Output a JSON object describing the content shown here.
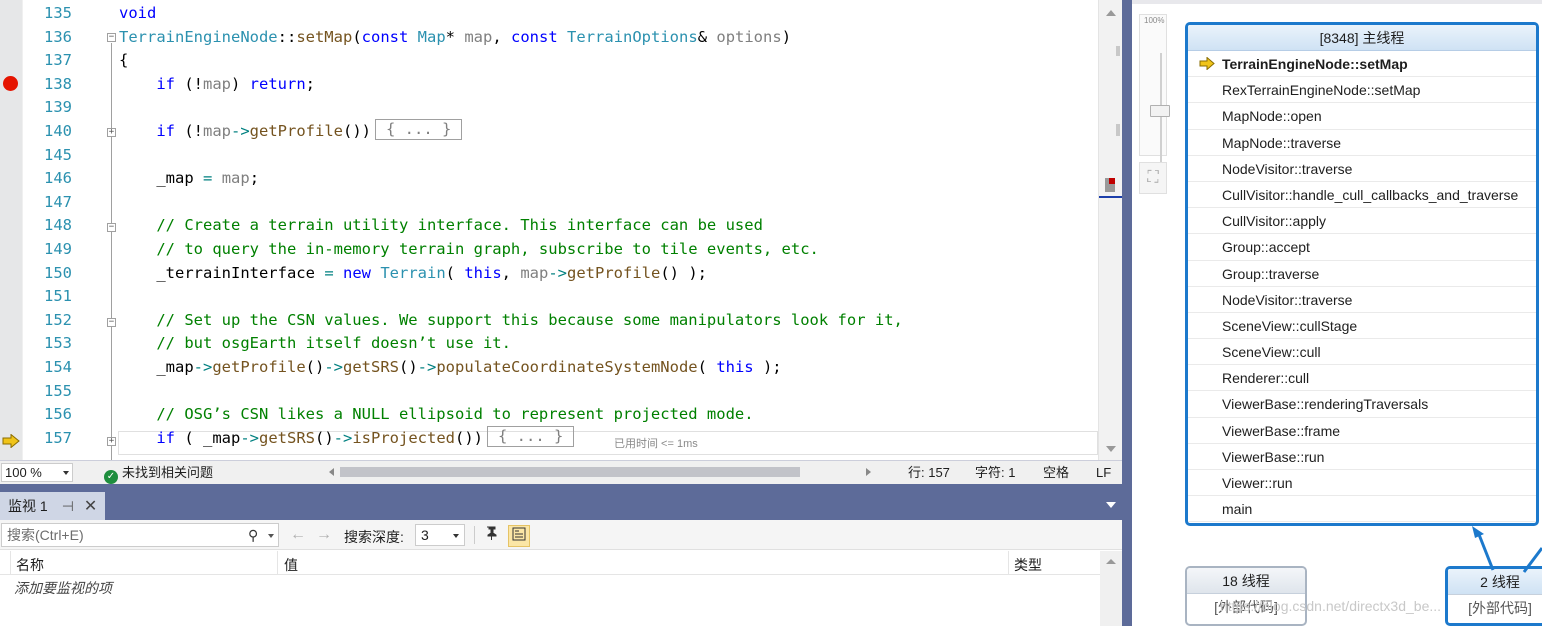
{
  "editor": {
    "lines": [
      {
        "n": "135",
        "html": "<span class=\"kw\">void</span>"
      },
      {
        "n": "136",
        "html": "<span class=\"ty\">TerrainEngineNode</span>::<span class=\"fn\">setMap</span>(<span class=\"kw\">const</span> <span class=\"ty\">Map</span>* <span class=\"mv\">map</span>, <span class=\"kw\">const</span> <span class=\"ty\">TerrainOptions</span>&amp; <span class=\"mv\">options</span>)"
      },
      {
        "n": "137",
        "html": "{"
      },
      {
        "n": "138",
        "html": "    <span class=\"kw\">if</span> (!<span class=\"mv\">map</span>) <span class=\"kw\">return</span>;"
      },
      {
        "n": "139",
        "html": ""
      },
      {
        "n": "140",
        "html": "    <span class=\"kw\">if</span> (!<span class=\"mv\">map</span><span class=\"op\">-&gt;</span><span class=\"fn\">getProfile</span>())<span class=\"collapsed\">{ ... }</span>"
      },
      {
        "n": "145",
        "html": ""
      },
      {
        "n": "146",
        "html": "    _map <span class=\"op\">=</span> <span class=\"mv\">map</span>;"
      },
      {
        "n": "147",
        "html": ""
      },
      {
        "n": "148",
        "html": "    <span class=\"cm\">// Create a terrain utility interface. This interface can be used</span>"
      },
      {
        "n": "149",
        "html": "    <span class=\"cm\">// to query the in-memory terrain graph, subscribe to tile events, etc.</span>"
      },
      {
        "n": "150",
        "html": "    _terrainInterface <span class=\"op\">=</span> <span class=\"kw\">new</span> <span class=\"ty\">Terrain</span>( <span class=\"kw\">this</span>, <span class=\"mv\">map</span><span class=\"op\">-&gt;</span><span class=\"fn\">getProfile</span>() );"
      },
      {
        "n": "151",
        "html": ""
      },
      {
        "n": "152",
        "html": "    <span class=\"cm\">// Set up the CSN values. We support this because some manipulators look for it,</span>"
      },
      {
        "n": "153",
        "html": "    <span class=\"cm\">// but osgEarth itself doesn’t use it.</span>"
      },
      {
        "n": "154",
        "html": "    _map<span class=\"op\">-&gt;</span><span class=\"fn\">getProfile</span>()<span class=\"op\">-&gt;</span><span class=\"fn\">getSRS</span>()<span class=\"op\">-&gt;</span><span class=\"fn\">populateCoordinateSystemNode</span>( <span class=\"kw\">this</span> );"
      },
      {
        "n": "155",
        "html": ""
      },
      {
        "n": "156",
        "html": "    <span class=\"cm\">// OSG’s CSN likes a NULL ellipsoid to represent projected mode.</span>"
      },
      {
        "n": "157",
        "html": "    <span class=\"kw\">if</span> ( _map<span class=\"op\">-&gt;</span><span class=\"fn\">getSRS</span>()<span class=\"op\">-&gt;</span><span class=\"fn\">isProjected</span>())<span class=\"collapsed\">{ ... }</span>"
      }
    ],
    "elapsed": "已用时间 <= 1ms",
    "breakpoint_line": "138",
    "current_line": "157"
  },
  "statusbar": {
    "zoom": "100 %",
    "issues": "未找到相关问题",
    "line": "行: 157",
    "col": "字符: 1",
    "whitespace": "空格",
    "eol": "LF"
  },
  "watch": {
    "title": "监视 1",
    "search_placeholder": "搜索(Ctrl+E)",
    "depth_label": "搜索深度:",
    "depth_value": "3",
    "col_name": "名称",
    "col_value": "值",
    "col_type": "类型",
    "add_item": "添加要监视的项"
  },
  "stacks": {
    "zoom_label": "100%",
    "main_thread": {
      "title": "[8348] 主线程",
      "frames": [
        "TerrainEngineNode::setMap",
        "RexTerrainEngineNode::setMap",
        "MapNode::open",
        "MapNode::traverse",
        "NodeVisitor::traverse",
        "CullVisitor::handle_cull_callbacks_and_traverse",
        "CullVisitor::apply",
        "Group::accept",
        "Group::traverse",
        "NodeVisitor::traverse",
        "SceneView::cullStage",
        "SceneView::cull",
        "Renderer::cull",
        "ViewerBase::renderingTraversals",
        "ViewerBase::frame",
        "ViewerBase::run",
        "Viewer::run",
        "main"
      ]
    },
    "thread_a": {
      "title": "18 线程",
      "body": "[外部代码]"
    },
    "thread_b": {
      "title": "2 线程",
      "body": "[外部代码]"
    },
    "watermark": "https://blog.csdn.net/directx3d_be..."
  },
  "colors": {
    "accent": "#1c79cc",
    "panel_title": "#5d6b99",
    "breakpoint": "#e51400",
    "ip_arrow": "#f0c419"
  }
}
